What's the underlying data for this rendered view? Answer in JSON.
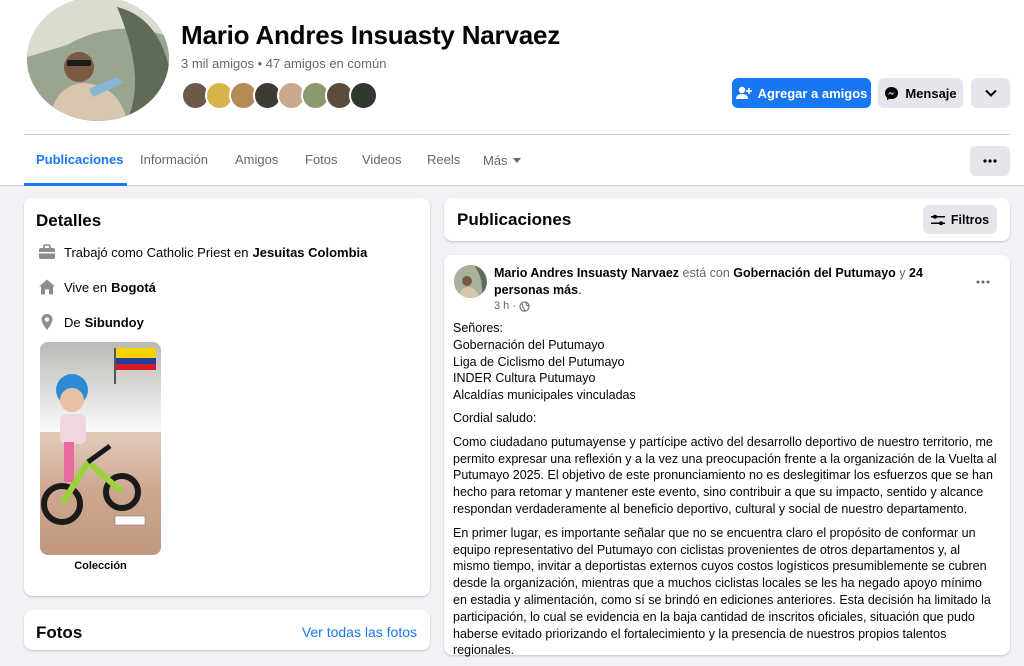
{
  "profile": {
    "name": "Mario Andres Insuasty Narvaez",
    "friends_summary": "3 mil amigos • 47 amigos en común",
    "mutual_friend_avatars": [
      "#6b5a48",
      "#d8b24a",
      "#b58a56",
      "#3e3a34",
      "#c9a88c",
      "#8a9a6e",
      "#5c4c3a",
      "#2f3a2e"
    ],
    "buttons": {
      "add_friend": "Agregar a amigos",
      "message": "Mensaje"
    }
  },
  "tabs": [
    {
      "label": "Publicaciones",
      "active": true
    },
    {
      "label": "Información"
    },
    {
      "label": "Amigos"
    },
    {
      "label": "Fotos"
    },
    {
      "label": "Videos"
    },
    {
      "label": "Reels"
    },
    {
      "label": "Más"
    }
  ],
  "details": {
    "title": "Detalles",
    "work_prefix": "Trabajó como Catholic Priest en",
    "work_place": "Jesuitas Colombia",
    "lives_prefix": "Vive en",
    "lives_place": "Bogotá",
    "from_prefix": "De",
    "from_place": "Sibundoy",
    "collection_label": "Colección"
  },
  "photos_section": {
    "title": "Fotos",
    "see_all": "Ver todas las fotos"
  },
  "posts_header": {
    "title": "Publicaciones",
    "filters": "Filtros"
  },
  "post": {
    "author": "Mario Andres Insuasty Narvaez",
    "with_text": "está con",
    "tagged": "Gobernación del Putumayo",
    "and_text": "y",
    "others": "24 personas más",
    "period": ".",
    "time": "3 h ·",
    "greeting_lines": [
      "Señores:",
      "Gobernación del Putumayo",
      "Liga de Ciclismo del Putumayo",
      "INDER Cultura Putumayo",
      "Alcaldías municipales vinculadas"
    ],
    "salutation": "Cordial saludo:",
    "paragraph1": "Como ciudadano putumayense y partícipe activo del desarrollo deportivo de nuestro territorio, me permito expresar una reflexión y a la vez una preocupación frente a la organización de la Vuelta al Putumayo 2025. El objetivo de este pronunciamiento no es deslegitimar los esfuerzos que se han hecho para retomar y mantener este evento, sino contribuir a que su impacto, sentido y alcance respondan verdaderamente al beneficio deportivo, cultural y social de nuestro departamento.",
    "paragraph2": "En primer lugar, es importante señalar que no se encuentra claro el propósito de conformar un equipo representativo del Putumayo con ciclistas provenientes de otros departamentos y, al mismo tiempo, invitar a deportistas externos cuyos costos logísticos presumiblemente se cubren desde la organización, mientras que a muchos ciclistas locales se les ha negado apoyo mínimo en estadia y alimentación, como sí se brindó en ediciones anteriores. Esta decisión ha limitado la participación, lo cual se evidencia en la baja cantidad de inscritos oficiales, situación que pudo haberse evitado priorizando el fortalecimiento y la presencia de nuestros propios talentos regionales."
  },
  "colors": {
    "accent": "#1877f2",
    "page_bg": "#f0f2f5",
    "secondary_text": "#65676b",
    "button_gray": "#e4e6eb"
  }
}
